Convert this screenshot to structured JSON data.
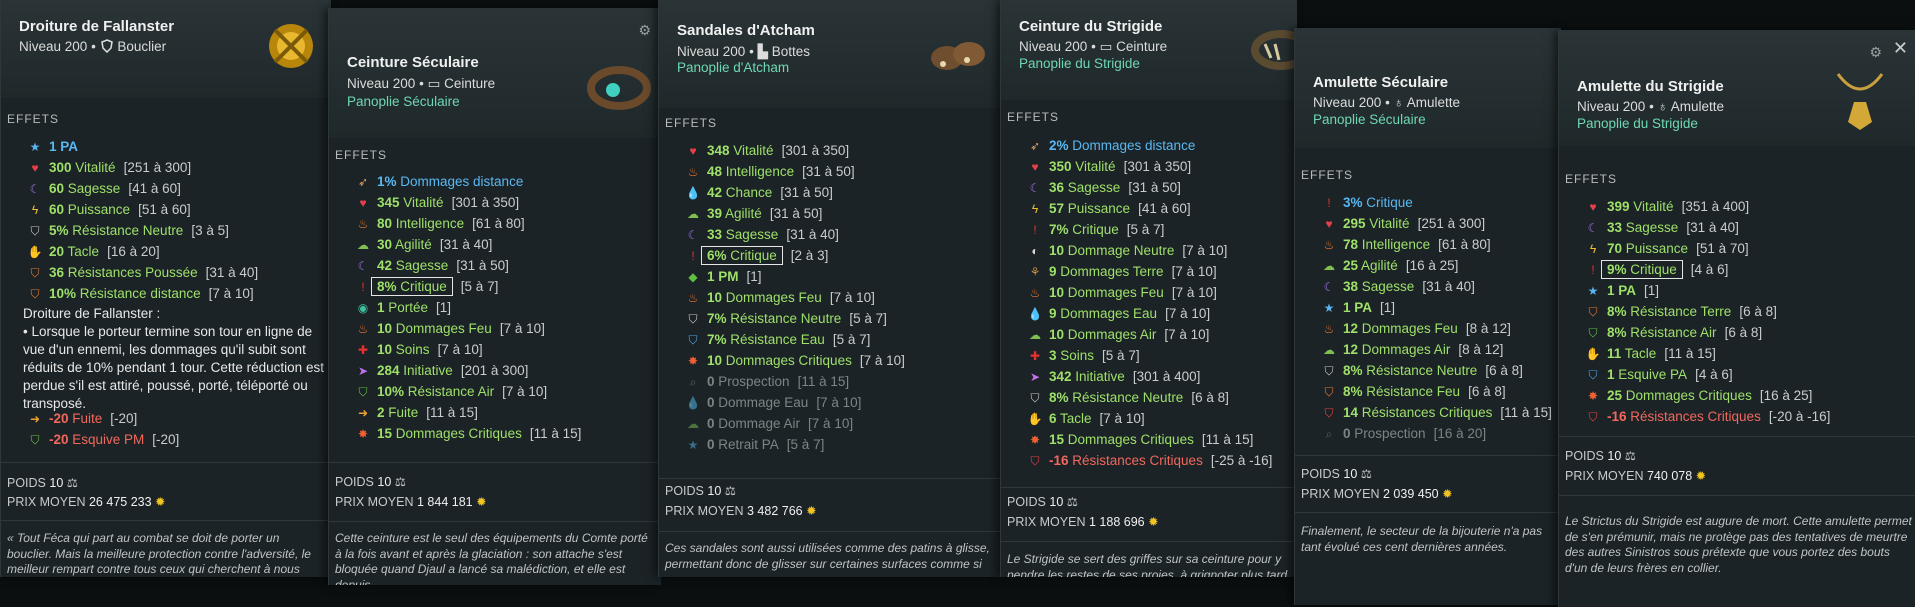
{
  "common": {
    "effects_label": "EFFETS",
    "weight_label": "POIDS",
    "price_label": "PRIX MOYEN",
    "sep": "•"
  },
  "cards": [
    {
      "name": "Droiture de Fallanster",
      "level": "Niveau 200",
      "type": "Bouclier",
      "set": "",
      "effects": [
        {
          "icon": "star-icon",
          "value": "1 PA",
          "range": "",
          "color": "b"
        },
        {
          "icon": "heart-icon",
          "value": "300",
          "name": "Vitalité",
          "range": "[251 à 300]",
          "color": "g"
        },
        {
          "icon": "moon-icon",
          "value": "60",
          "name": "Sagesse",
          "range": "[41 à 60]",
          "color": "g"
        },
        {
          "icon": "bolt-icon",
          "value": "60",
          "name": "Puissance",
          "range": "[51 à 60]",
          "color": "g"
        },
        {
          "icon": "shield-icon",
          "value": "5%",
          "name": "Résistance Neutre",
          "range": "[3 à 5]",
          "color": "g"
        },
        {
          "icon": "tackle-icon",
          "value": "20",
          "name": "Tacle",
          "range": "[16 à 20]",
          "color": "g"
        },
        {
          "icon": "shield-orange-icon",
          "value": "36",
          "name": "Résistances Poussée",
          "range": "[31 à 40]",
          "color": "g"
        },
        {
          "icon": "shield-orange-icon",
          "value": "10%",
          "name": "Résistance distance",
          "range": "[7 à 10]",
          "color": "g"
        }
      ],
      "special_title": "Droiture de Fallanster :",
      "special_text": "• Lorsque le porteur termine son tour en ligne de vue d'un ennemi, les dommages qu'il subit sont réduits de 10% pendant 1 tour. Cette réduction est perdue s'il est attiré, poussé, porté, téléporté ou transposé.",
      "malus": [
        {
          "icon": "flee-icon",
          "value": "-20",
          "name": "Fuite",
          "range": "[-20]",
          "color": "r"
        },
        {
          "icon": "dodge-icon",
          "value": "-20",
          "name": "Esquive PM",
          "range": "[-20]",
          "color": "r"
        }
      ],
      "weight": "10",
      "price": "26 475 233",
      "lore": "« Tout Féca qui part au combat se doit de porter un bouclier. Mais la meilleure protection contre l'adversité, le meilleur rempart contre tous ceux qui cherchent à nous nuire ou à"
    },
    {
      "name": "Ceinture Séculaire",
      "level": "Niveau 200",
      "type": "Ceinture",
      "set": "Panoplie Séculaire",
      "effects": [
        {
          "icon": "bow-icon",
          "value": "1%",
          "name": "Dommages distance",
          "range": "",
          "color": "b"
        },
        {
          "icon": "heart-icon",
          "value": "345",
          "name": "Vitalité",
          "range": "[301 à 350]",
          "color": "g"
        },
        {
          "icon": "fire-icon",
          "value": "80",
          "name": "Intelligence",
          "range": "[61 à 80]",
          "color": "g"
        },
        {
          "icon": "cloud-icon",
          "value": "30",
          "name": "Agilité",
          "range": "[31 à 40]",
          "color": "g"
        },
        {
          "icon": "moon-icon",
          "value": "42",
          "name": "Sagesse",
          "range": "[31 à 50]",
          "color": "g"
        },
        {
          "icon": "crit-icon",
          "value": "8%",
          "name": "Critique",
          "range": "[5 à 7]",
          "color": "g",
          "boxed": true
        },
        {
          "icon": "eye-icon",
          "value": "1",
          "name": "Portée",
          "range": "[1]",
          "color": "g"
        },
        {
          "icon": "fire-icon",
          "value": "10",
          "name": "Dommages Feu",
          "range": "[7 à 10]",
          "color": "g"
        },
        {
          "icon": "cross-icon",
          "value": "10",
          "name": "Soins",
          "range": "[7 à 10]",
          "color": "g"
        },
        {
          "icon": "init-icon",
          "value": "284",
          "name": "Initiative",
          "range": "[201 à 300]",
          "color": "g"
        },
        {
          "icon": "shield-green-icon",
          "value": "10%",
          "name": "Résistance Air",
          "range": "[7 à 10]",
          "color": "g"
        },
        {
          "icon": "flee-icon",
          "value": "2",
          "name": "Fuite",
          "range": "[11 à 15]",
          "color": "g"
        },
        {
          "icon": "burst-icon",
          "value": "15",
          "name": "Dommages Critiques",
          "range": "[11 à 15]",
          "color": "g"
        }
      ],
      "weight": "10",
      "price": "1 844 181",
      "lore": "Cette ceinture est le seul des équipements du Comte porté à la fois avant et après la glaciation : son attache s'est bloquée quand Djaul a lancé sa malédiction, et elle est depuis"
    },
    {
      "name": "Sandales d'Atcham",
      "level": "Niveau 200",
      "type": "Bottes",
      "set": "Panoplie d'Atcham",
      "effects": [
        {
          "icon": "heart-icon",
          "value": "348",
          "name": "Vitalité",
          "range": "[301 à 350]",
          "color": "g"
        },
        {
          "icon": "fire-icon",
          "value": "48",
          "name": "Intelligence",
          "range": "[31 à 50]",
          "color": "g"
        },
        {
          "icon": "drop-icon",
          "value": "42",
          "name": "Chance",
          "range": "[31 à 50]",
          "color": "g"
        },
        {
          "icon": "cloud-icon",
          "value": "39",
          "name": "Agilité",
          "range": "[31 à 50]",
          "color": "g"
        },
        {
          "icon": "moon-icon",
          "value": "33",
          "name": "Sagesse",
          "range": "[31 à 40]",
          "color": "g"
        },
        {
          "icon": "crit-icon",
          "value": "6%",
          "name": "Critique",
          "range": "[2 à 3]",
          "color": "g",
          "boxed": true
        },
        {
          "icon": "diamond-icon",
          "value": "1 PM",
          "name": "",
          "range": "[1]",
          "color": "g"
        },
        {
          "icon": "fire-icon",
          "value": "10",
          "name": "Dommages Feu",
          "range": "[7 à 10]",
          "color": "g"
        },
        {
          "icon": "shield-icon",
          "value": "7%",
          "name": "Résistance Neutre",
          "range": "[5 à 7]",
          "color": "g"
        },
        {
          "icon": "shield-blue-icon",
          "value": "7%",
          "name": "Résistance Eau",
          "range": "[5 à 7]",
          "color": "g"
        },
        {
          "icon": "burst-icon",
          "value": "10",
          "name": "Dommages Critiques",
          "range": "[7 à 10]",
          "color": "g"
        },
        {
          "icon": "search-icon",
          "value": "0",
          "name": "Prospection",
          "range": "[11 à 15]",
          "color": "x"
        },
        {
          "icon": "drop-icon",
          "value": "0",
          "name": "Dommage Eau",
          "range": "[7 à 10]",
          "color": "x"
        },
        {
          "icon": "cloud-icon",
          "value": "0",
          "name": "Dommage Air",
          "range": "[7 à 10]",
          "color": "x"
        },
        {
          "icon": "star-icon",
          "value": "0",
          "name": "Retrait PA",
          "range": "[5 à 7]",
          "color": "x"
        }
      ],
      "weight": "10",
      "price": "3 482 766",
      "lore": "Ces sandales sont aussi utilisées comme des patins à glisse, permettant donc de glisser sur certaines surfaces comme si"
    },
    {
      "name": "Ceinture du Strigide",
      "level": "Niveau 200",
      "type": "Ceinture",
      "set": "Panoplie du Strigide",
      "effects": [
        {
          "icon": "bow-icon",
          "value": "2%",
          "name": "Dommages distance",
          "range": "",
          "color": "b"
        },
        {
          "icon": "heart-icon",
          "value": "350",
          "name": "Vitalité",
          "range": "[301 à 350]",
          "color": "g"
        },
        {
          "icon": "moon-icon",
          "value": "36",
          "name": "Sagesse",
          "range": "[31 à 50]",
          "color": "g"
        },
        {
          "icon": "bolt-icon",
          "value": "57",
          "name": "Puissance",
          "range": "[41 à 60]",
          "color": "g"
        },
        {
          "icon": "crit-icon",
          "value": "7%",
          "name": "Critique",
          "range": "[5 à 7]",
          "color": "g"
        },
        {
          "icon": "neutral-icon",
          "value": "10",
          "name": "Dommage Neutre",
          "range": "[7 à 10]",
          "color": "g"
        },
        {
          "icon": "earth-icon",
          "value": "9",
          "name": "Dommages Terre",
          "range": "[7 à 10]",
          "color": "g"
        },
        {
          "icon": "fire-icon",
          "value": "10",
          "name": "Dommages Feu",
          "range": "[7 à 10]",
          "color": "g"
        },
        {
          "icon": "drop-icon",
          "value": "9",
          "name": "Dommages Eau",
          "range": "[7 à 10]",
          "color": "g"
        },
        {
          "icon": "cloud-icon",
          "value": "10",
          "name": "Dommages Air",
          "range": "[7 à 10]",
          "color": "g"
        },
        {
          "icon": "cross-icon",
          "value": "3",
          "name": "Soins",
          "range": "[5 à 7]",
          "color": "g"
        },
        {
          "icon": "init-icon",
          "value": "342",
          "name": "Initiative",
          "range": "[301 à 400]",
          "color": "g"
        },
        {
          "icon": "shield-icon",
          "value": "8%",
          "name": "Résistance Neutre",
          "range": "[6 à 8]",
          "color": "g"
        },
        {
          "icon": "tackle-icon",
          "value": "6",
          "name": "Tacle",
          "range": "[7 à 10]",
          "color": "g"
        },
        {
          "icon": "burst-icon",
          "value": "15",
          "name": "Dommages Critiques",
          "range": "[11 à 15]",
          "color": "g"
        },
        {
          "icon": "crit-shield-icon",
          "value": "-16",
          "name": "Résistances Critiques",
          "range": "[-25 à -16]",
          "color": "r"
        }
      ],
      "weight": "10",
      "price": "1 188 696",
      "lore": "Le Strigide se sert des griffes sur sa ceinture pour y pendre les restes de ses proies, à grignoter plus tard. Essayez déjà de"
    },
    {
      "name": "Amulette Séculaire",
      "level": "Niveau 200",
      "type": "Amulette",
      "set": "Panoplie Séculaire",
      "effects": [
        {
          "icon": "crit-icon",
          "value": "3%",
          "name": "Critique",
          "range": "",
          "color": "b"
        },
        {
          "icon": "heart-icon",
          "value": "295",
          "name": "Vitalité",
          "range": "[251 à 300]",
          "color": "g"
        },
        {
          "icon": "fire-icon",
          "value": "78",
          "name": "Intelligence",
          "range": "[61 à 80]",
          "color": "g"
        },
        {
          "icon": "cloud-icon",
          "value": "25",
          "name": "Agilité",
          "range": "[16 à 25]",
          "color": "g"
        },
        {
          "icon": "moon-icon",
          "value": "38",
          "name": "Sagesse",
          "range": "[31 à 40]",
          "color": "g"
        },
        {
          "icon": "star-icon",
          "value": "1 PA",
          "name": "",
          "range": "[1]",
          "color": "g"
        },
        {
          "icon": "fire-icon",
          "value": "12",
          "name": "Dommages Feu",
          "range": "[8 à 12]",
          "color": "g"
        },
        {
          "icon": "cloud-icon",
          "value": "12",
          "name": "Dommages Air",
          "range": "[8 à 12]",
          "color": "g"
        },
        {
          "icon": "shield-icon",
          "value": "8%",
          "name": "Résistance Neutre",
          "range": "[6 à 8]",
          "color": "g"
        },
        {
          "icon": "shield-orange-icon",
          "value": "8%",
          "name": "Résistance Feu",
          "range": "[6 à 8]",
          "color": "g"
        },
        {
          "icon": "crit-shield-icon",
          "value": "14",
          "name": "Résistances Critiques",
          "range": "[11 à 15]",
          "color": "g"
        },
        {
          "icon": "search-icon",
          "value": "0",
          "name": "Prospection",
          "range": "[16 à 20]",
          "color": "x"
        }
      ],
      "weight": "10",
      "price": "2 039 450",
      "lore": "Finalement, le secteur de la bijouterie n'a pas tant évolué ces cent dernières années."
    },
    {
      "name": "Amulette du Strigide",
      "level": "Niveau 200",
      "type": "Amulette",
      "set": "Panoplie du Strigide",
      "effects": [
        {
          "icon": "heart-icon",
          "value": "399",
          "name": "Vitalité",
          "range": "[351 à 400]",
          "color": "g"
        },
        {
          "icon": "moon-icon",
          "value": "33",
          "name": "Sagesse",
          "range": "[31 à 40]",
          "color": "g"
        },
        {
          "icon": "bolt-icon",
          "value": "70",
          "name": "Puissance",
          "range": "[51 à 70]",
          "color": "g"
        },
        {
          "icon": "crit-icon",
          "value": "9%",
          "name": "Critique",
          "range": "[4 à 6]",
          "color": "g",
          "boxed": true
        },
        {
          "icon": "star-icon",
          "value": "1 PA",
          "name": "",
          "range": "[1]",
          "color": "g"
        },
        {
          "icon": "shield-orange-icon",
          "value": "8%",
          "name": "Résistance Terre",
          "range": "[6 à 8]",
          "color": "g"
        },
        {
          "icon": "shield-green-icon",
          "value": "8%",
          "name": "Résistance Air",
          "range": "[6 à 8]",
          "color": "g"
        },
        {
          "icon": "tackle-icon",
          "value": "11",
          "name": "Tacle",
          "range": "[11 à 15]",
          "color": "g"
        },
        {
          "icon": "dodge-blue-icon",
          "value": "1",
          "name": "Esquive PA",
          "range": "[4 à 6]",
          "color": "g"
        },
        {
          "icon": "burst-icon",
          "value": "25",
          "name": "Dommages Critiques",
          "range": "[16 à 25]",
          "color": "g"
        },
        {
          "icon": "crit-shield-icon",
          "value": "-16",
          "name": "Résistances Critiques",
          "range": "[-20 à -16]",
          "color": "r"
        }
      ],
      "weight": "10",
      "price": "740 078",
      "lore": "Le Strictus du Strigide est augure de mort. Cette amulette permet de s'en prémunir, mais ne protège pas des tentatives de meurtre des autres Sinistros sous prétexte que vous portez des bouts d'un de leurs frères en collier."
    }
  ],
  "colors": {
    "bonus": "#9fe06a",
    "base": "#59b8f2",
    "malus": "#f2685d",
    "set": "#6fd7b3",
    "kamas": "#f2c420"
  }
}
